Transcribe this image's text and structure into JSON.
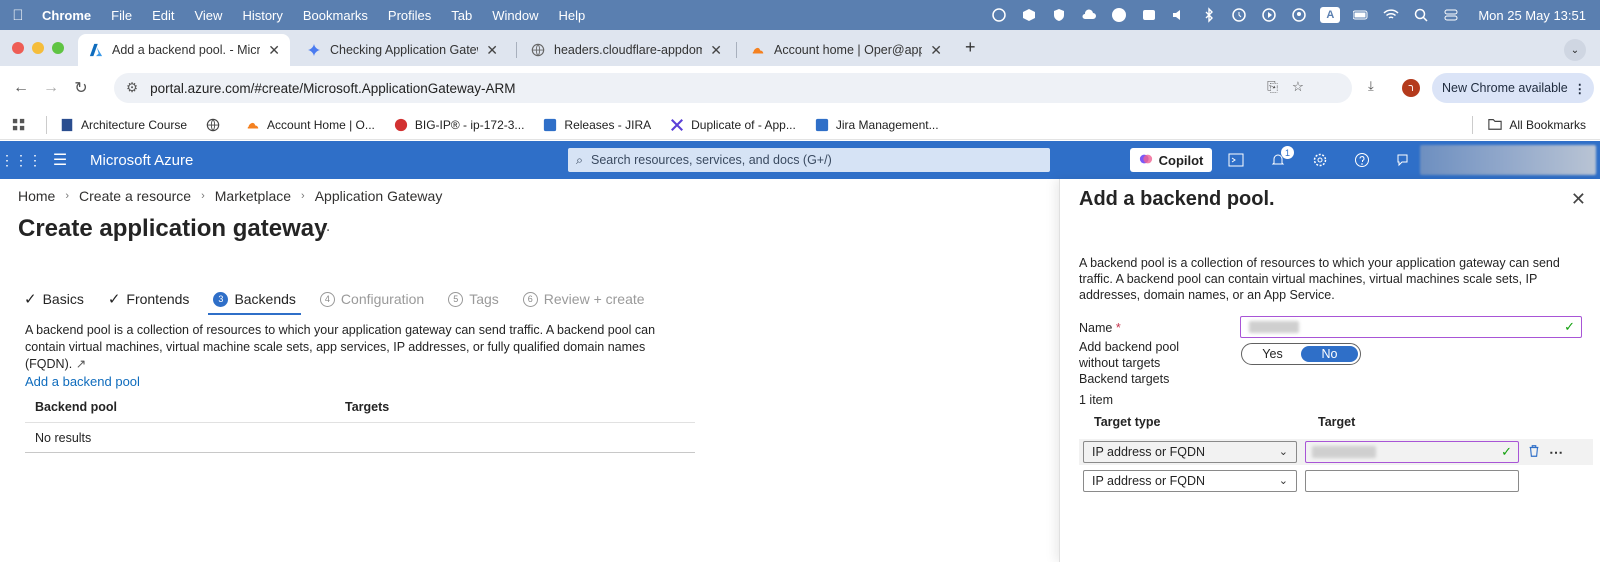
{
  "menubar": {
    "app": "Chrome",
    "items": [
      "File",
      "Edit",
      "View",
      "History",
      "Bookmarks",
      "Profiles",
      "Tab",
      "Window",
      "Help"
    ],
    "input_badge": "A",
    "clock": "Mon 25 May  13:51"
  },
  "tabs": [
    {
      "title": "Add a backend pool. - Micros",
      "icon": "azure-icon"
    },
    {
      "title": "Checking Application Gatewa",
      "icon": "gemini-icon"
    },
    {
      "title": "headers.cloudflare-appdome",
      "icon": "globe-icon"
    },
    {
      "title": "Account home | Oper@appdo",
      "icon": "cloudflare-icon"
    }
  ],
  "address": {
    "url": "portal.azure.com/#create/Microsoft.ApplicationGateway-ARM",
    "update_label": "New Chrome available",
    "profile_initial": "ר"
  },
  "bookmarks": [
    {
      "label": "Architecture Course"
    },
    {
      "label": ""
    },
    {
      "label": "Account Home | O..."
    },
    {
      "label": "BIG-IP® - ip-172-3..."
    },
    {
      "label": "Releases - JIRA"
    },
    {
      "label": "Duplicate of - App..."
    },
    {
      "label": "Jira Management..."
    }
  ],
  "all_bookmarks": "All Bookmarks",
  "azure": {
    "brand": "Microsoft Azure",
    "search_placeholder": "Search resources, services, and docs (G+/)",
    "copilot": "Copilot",
    "notif_count": "1"
  },
  "breadcrumb": [
    "Home",
    "Create a resource",
    "Marketplace",
    "Application Gateway"
  ],
  "page": {
    "title": "Create application gateway",
    "more": "...",
    "steps": [
      {
        "label": "Basics",
        "state": "done"
      },
      {
        "label": "Frontends",
        "state": "done"
      },
      {
        "label": "Backends",
        "state": "current",
        "num": "3"
      },
      {
        "label": "Configuration",
        "state": "disabled",
        "num": "4"
      },
      {
        "label": "Tags",
        "state": "disabled",
        "num": "5"
      },
      {
        "label": "Review + create",
        "state": "disabled",
        "num": "6"
      }
    ],
    "description": "A backend pool is a collection of resources to which your application gateway can send traffic. A backend pool can contain virtual machines, virtual machine scale sets, app services, IP addresses, or fully qualified domain names (FQDN).",
    "add_link": "Add a backend pool",
    "table_headers": [
      "Backend pool",
      "Targets"
    ],
    "no_results": "No results"
  },
  "blade": {
    "title": "Add a backend pool.",
    "description": "A backend pool is a collection of resources to which your application gateway can send traffic. A backend pool can contain virtual machines, virtual machines scale sets, IP addresses, domain names, or an App Service.",
    "name_label": "Name",
    "required_mark": "*",
    "without_targets_label": "Add backend pool without targets",
    "toggle_yes": "Yes",
    "toggle_no": "No",
    "toggle_selected": "No",
    "backend_targets_label": "Backend targets",
    "item_count": "1 item",
    "col_target_type": "Target type",
    "col_target": "Target",
    "rows": [
      {
        "target_type": "IP address or FQDN"
      },
      {
        "target_type": "IP address or FQDN"
      }
    ]
  },
  "colors": {
    "azure_blue": "#2f6fc8",
    "menubar": "#5a7fb0",
    "link": "#0f6cbd",
    "valid_green": "#13a10e",
    "focus_purple": "#a855d6"
  }
}
